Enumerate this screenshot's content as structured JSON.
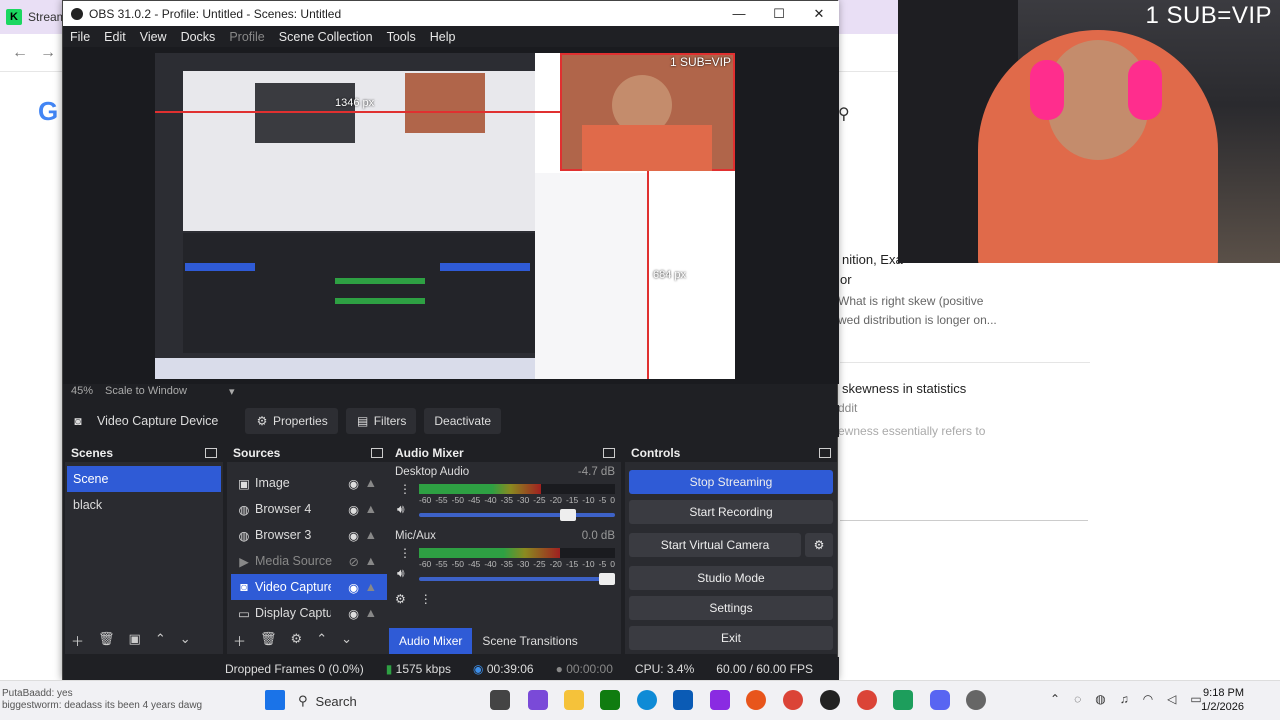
{
  "browser": {
    "tab_title": "Stream",
    "nav_back": "←",
    "nav_forward": "→"
  },
  "search_result": {
    "g_logo": "G",
    "r1_line1": "nition, Exa",
    "r1_line2": "or",
    "r1_snip1": "What is right skew (positive",
    "r1_snip2": "wed distribution is longer on...",
    "r2_title": "skewness in statistics",
    "r2_sub": "ddit",
    "r2_snip": "ewness essentially refers to"
  },
  "webcam": {
    "overlay_text": "1 SUB=VIP"
  },
  "obs": {
    "window_title": "OBS 31.0.2 - Profile: Untitled - Scenes: Untitled",
    "window_controls": {
      "minimize": "—",
      "maximize": "☐",
      "close": "✕"
    },
    "menu": [
      "File",
      "Edit",
      "View",
      "Docks",
      "Profile",
      "Scene Collection",
      "Tools",
      "Help"
    ],
    "preview": {
      "overlay_text": "1 SUB=VIP",
      "label_width": "1346 px",
      "label_height": "684 px",
      "zoom": "45%",
      "scale_mode": "Scale to Window"
    },
    "source_toolbar": {
      "source_name": "Video Capture Device",
      "properties": "Properties",
      "filters": "Filters",
      "deactivate": "Deactivate"
    },
    "scenes": {
      "header": "Scenes",
      "items": [
        "Scene",
        "black"
      ],
      "selected": "Scene"
    },
    "sources": {
      "header": "Sources",
      "items": [
        "Image",
        "Browser 4",
        "Browser 3",
        "Media Source",
        "Video Capture Device",
        "Display Capture"
      ],
      "selected": "Video Capture Device"
    },
    "audio_mixer": {
      "header": "Audio Mixer",
      "channels": [
        {
          "name": "Desktop Audio",
          "level": "-4.7 dB",
          "meter_fill": 0.62,
          "volume": 0.8
        },
        {
          "name": "Mic/Aux",
          "level": "0.0 dB",
          "meter_fill": 0.72,
          "volume": 1.0
        }
      ],
      "ticks": [
        "-60",
        "-55",
        "-50",
        "-45",
        "-40",
        "-35",
        "-30",
        "-25",
        "-20",
        "-15",
        "-10",
        "-5",
        "0"
      ],
      "tab_mixer": "Audio Mixer",
      "tab_transitions": "Scene Transitions"
    },
    "controls": {
      "header": "Controls",
      "stop_streaming": "Stop Streaming",
      "start_recording": "Start Recording",
      "start_virtual_camera": "Start Virtual Camera",
      "studio_mode": "Studio Mode",
      "settings": "Settings",
      "exit": "Exit"
    },
    "status": {
      "dropped_frames": "Dropped Frames 0 (0.0%)",
      "bitrate": "1575 kbps",
      "stream_time": "00:39:06",
      "record_time": "00:00:00",
      "cpu": "CPU: 3.4%",
      "fps": "60.00 / 60.00 FPS"
    }
  },
  "taskbar": {
    "search": "Search",
    "time": "9:18 PM",
    "date": "1/2/2026"
  },
  "chat": {
    "line1": "PutaBaadd: yes",
    "line2": "biggestworm: deadass its been 4 years dawg"
  },
  "colors": {
    "obs_bg": "#1f2024",
    "dock_bg": "#2a2b30",
    "accent": "#2f5bd6",
    "red_guide": "#e03030"
  }
}
